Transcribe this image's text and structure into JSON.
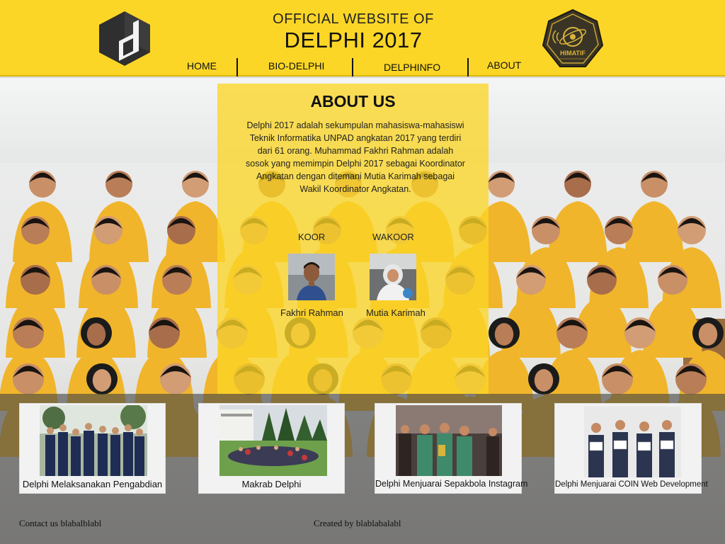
{
  "header": {
    "title_small": "OFFICIAL WEBSITE OF",
    "title_big": "DELPHI 2017",
    "logo_left_icon": "delphi-logo-icon",
    "logo_right_icon": "himatif-emblem-icon",
    "logo_right_text": "HIMATIF"
  },
  "nav": {
    "items": [
      {
        "label": "HOME"
      },
      {
        "label": "BIO-DELPHI"
      },
      {
        "label": "DELPHINFO"
      },
      {
        "label": "ABOUT"
      }
    ]
  },
  "about": {
    "title": "ABOUT US",
    "text": "Delphi 2017 adalah sekumpulan mahasiswa-mahasiswi Teknik Informatika UNPAD angkatan 2017 yang terdiri dari 61 orang. Muhammad Fakhri Rahman adalah sosok yang memimpin Delphi 2017 sebagai Koordinator Angkatan dengan ditemani Mutia Karimah sebagai Wakil Koordinator Angkatan.",
    "leaders": [
      {
        "role": "KOOR",
        "name": "Fakhri Rahman"
      },
      {
        "role": "WAKOOR",
        "name": "Mutia Karimah"
      }
    ]
  },
  "cards": [
    {
      "caption": "Delphi Melaksanakan Pengabdian"
    },
    {
      "caption": "Makrab Delphi"
    },
    {
      "caption": "Delphi Menjuarai Sepakbola Instagram"
    },
    {
      "caption": "Delphi Menjuarai COIN Web Development"
    }
  ],
  "footer": {
    "contact": "Contact us blabalblabl",
    "created": "Created by blablabalabl"
  },
  "colors": {
    "accent": "#fbd626",
    "jacket": "#f0b52b",
    "band": "#464646"
  }
}
